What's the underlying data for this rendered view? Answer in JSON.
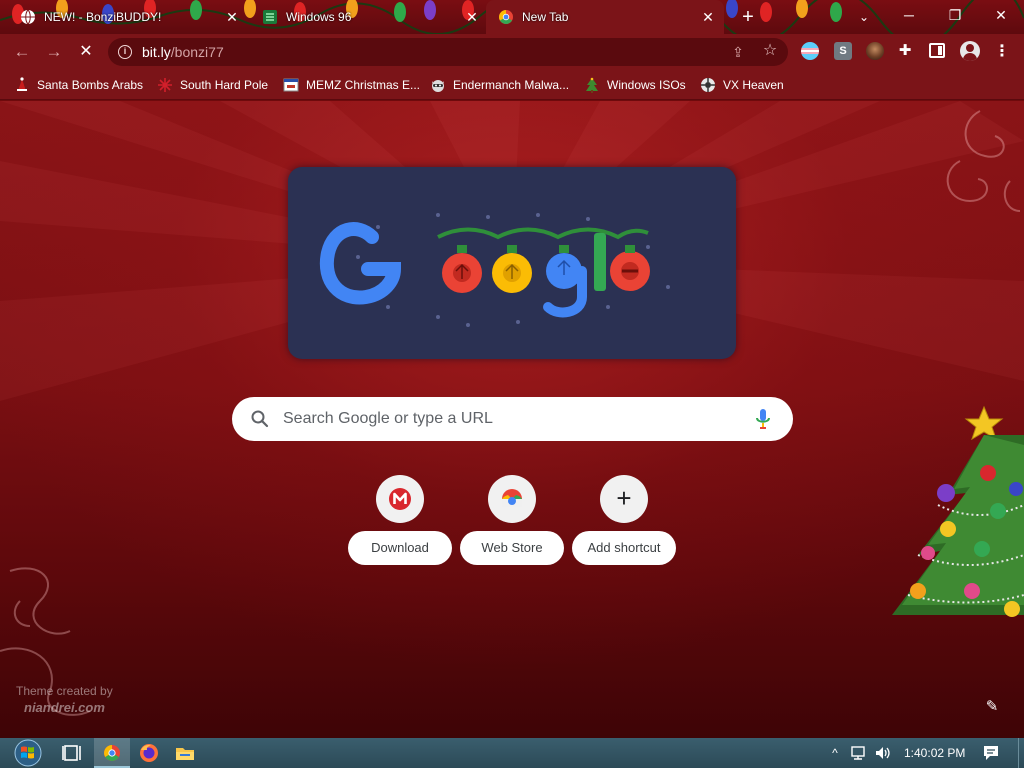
{
  "window": {
    "tabs": [
      {
        "title": "NEW! - BonziBUDDY!",
        "favicon": "globe-icon",
        "active": false
      },
      {
        "title": "Windows 96",
        "favicon": "windows96-icon",
        "active": false
      },
      {
        "title": "New Tab",
        "favicon": "chrome-icon",
        "active": true
      }
    ],
    "new_tab_label": "+",
    "tab_search_label": "⌄",
    "controls": {
      "minimize": "─",
      "restore": "❐",
      "close": "✕"
    }
  },
  "toolbar": {
    "back": "←",
    "forward": "→",
    "reload": "✕",
    "url_host": "bit.ly",
    "url_path": "/bonzi77",
    "extensions": [
      "trans-flag-icon",
      "s-extension-icon",
      "avatar-extension-icon",
      "puzzle-icon"
    ],
    "s_extension_label": "S",
    "menu": "⋮"
  },
  "bookmarks": [
    {
      "label": "Santa Bombs Arabs",
      "icon": "santa-icon"
    },
    {
      "label": "South Hard Pole",
      "icon": "snowflake-icon"
    },
    {
      "label": "MEMZ Christmas E...",
      "icon": "window-icon"
    },
    {
      "label": "Endermanch Malwa...",
      "icon": "raccoon-icon"
    },
    {
      "label": "Windows ISOs",
      "icon": "tree-icon"
    },
    {
      "label": "VX Heaven",
      "icon": "vx-heaven-icon"
    }
  ],
  "ntp": {
    "doodle_word": "Google",
    "search_placeholder": "Search Google or type a URL",
    "shortcuts": [
      {
        "label": "Download",
        "icon": "mega-icon"
      },
      {
        "label": "Web Store",
        "icon": "webstore-icon"
      },
      {
        "label": "Add shortcut",
        "icon": "plus-icon"
      }
    ],
    "add_glyph": "+",
    "theme_credit_line1": "Theme created by",
    "theme_credit_line2": "niandrei.com",
    "customize": "✎"
  },
  "taskbar": {
    "clock": "1:40:02 PM",
    "chevron": "^"
  },
  "colors": {
    "frame": "#7b1418",
    "tabstrip": "#5e0a0e",
    "omnibox": "#5a0a0e",
    "ntp_top": "#8a1417",
    "ntp_bottom": "#3e0406",
    "doodle_bg": "#2b3153",
    "taskbar": "#2c4a57",
    "google_blue": "#4285f4",
    "google_red": "#ea4335",
    "google_yellow": "#fbbc05",
    "google_green": "#34a853"
  }
}
